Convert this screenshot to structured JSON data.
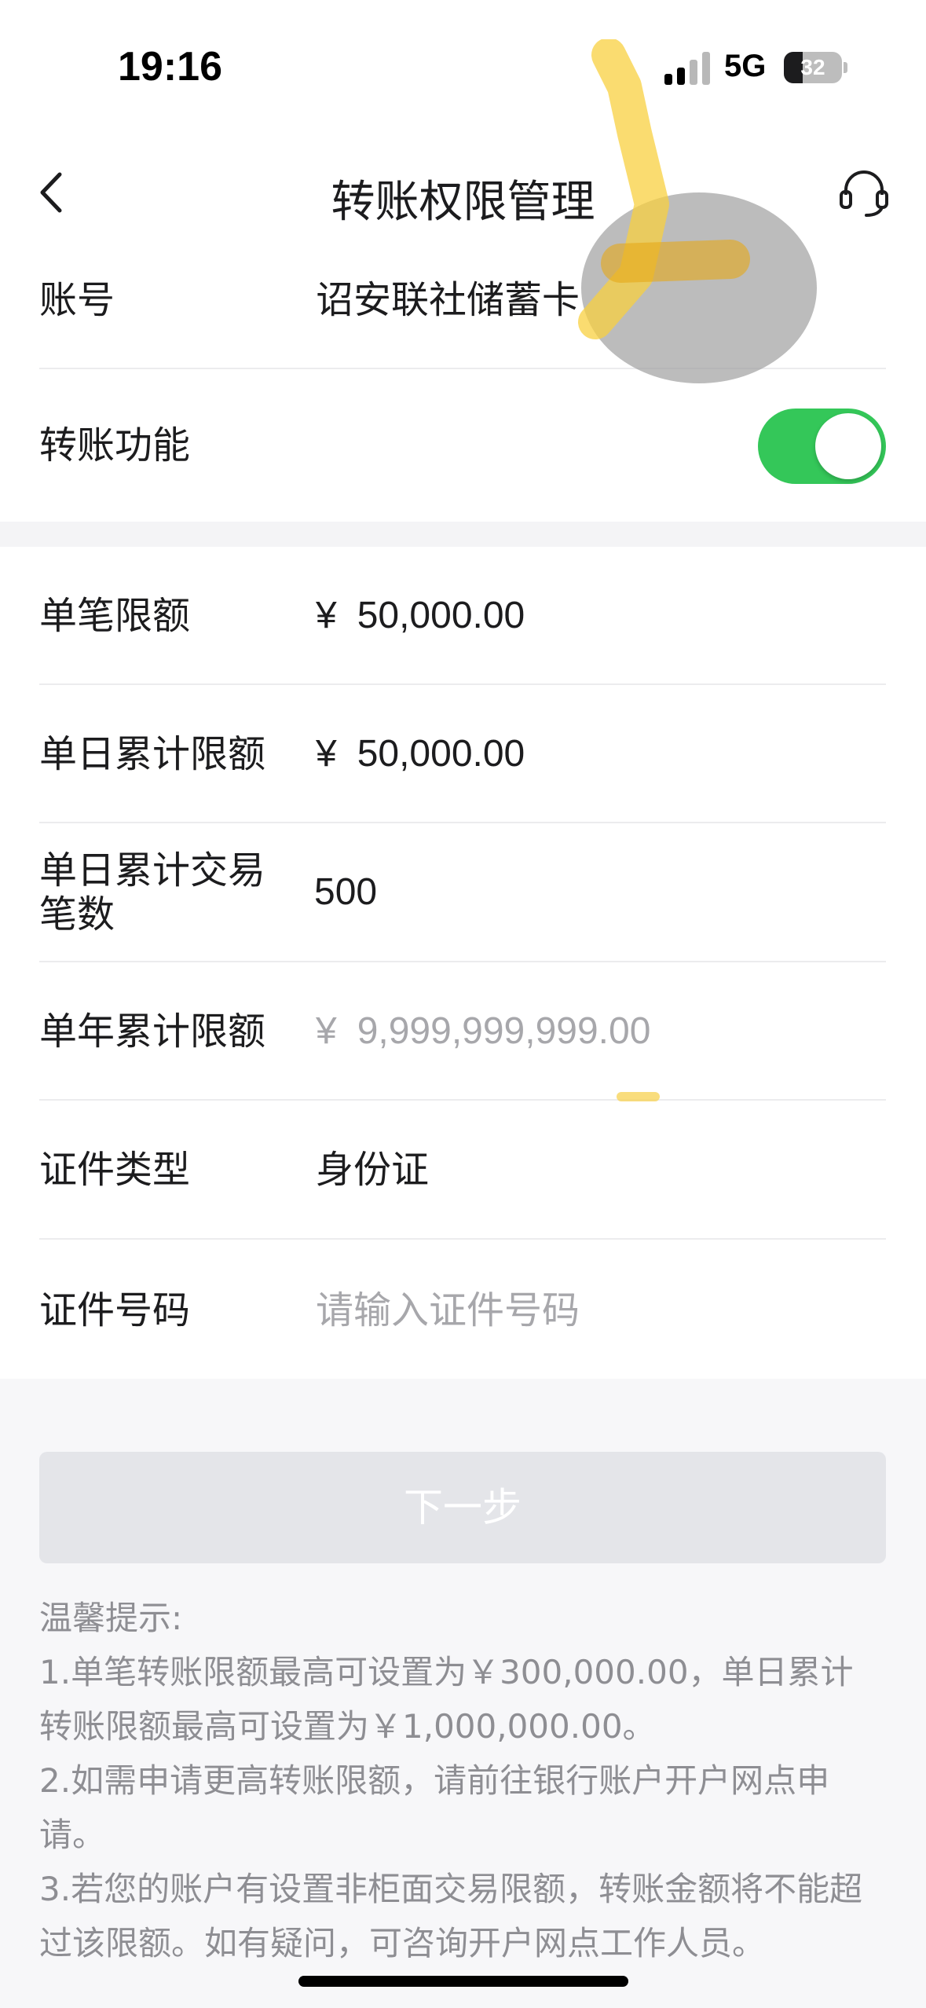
{
  "status_bar": {
    "time": "19:16",
    "network": "5G",
    "battery": "32",
    "battery_level": 0.32
  },
  "nav": {
    "title": "转账权限管理",
    "back_icon": "chevron-left-icon",
    "service_icon": "headset-icon"
  },
  "account": {
    "label": "账号",
    "value": "诏安联社储蓄卡"
  },
  "transfer_function": {
    "label": "转账功能",
    "enabled": true
  },
  "limits": {
    "currency": "¥",
    "single": {
      "label": "单笔限额",
      "value": "50,000.00"
    },
    "daily": {
      "label": "单日累计限额",
      "value": "50,000.00"
    },
    "daily_count": {
      "label_line1": "单日累计交易",
      "label_line2": "笔数",
      "value": "500"
    },
    "yearly": {
      "label": "单年累计限额",
      "value": "9,999,999,999.00"
    }
  },
  "id_type": {
    "label": "证件类型",
    "value": "身份证"
  },
  "id_number": {
    "label": "证件号码",
    "placeholder": "请输入证件号码"
  },
  "next_button": "下一步",
  "tips": {
    "title": "温馨提示:",
    "items": [
      "1.单笔转账限额最高可设置为￥300,000.00，单日累计转账限额最高可设置为￥1,000,000.00。",
      "2.如需申请更高转账限额，请前往银行账户开户网点申请。",
      "3.若您的账户有设置非柜面交易限额，转账金额将不能超过该限额。如有疑问，可咨询开户网点工作人员。"
    ]
  },
  "colors": {
    "toggle_on": "#34c759",
    "button_disabled": "#e4e5e9",
    "tips_text": "#8e8e93",
    "placeholder": "#a7a7ab",
    "redaction_yellow": "#f8d040"
  }
}
